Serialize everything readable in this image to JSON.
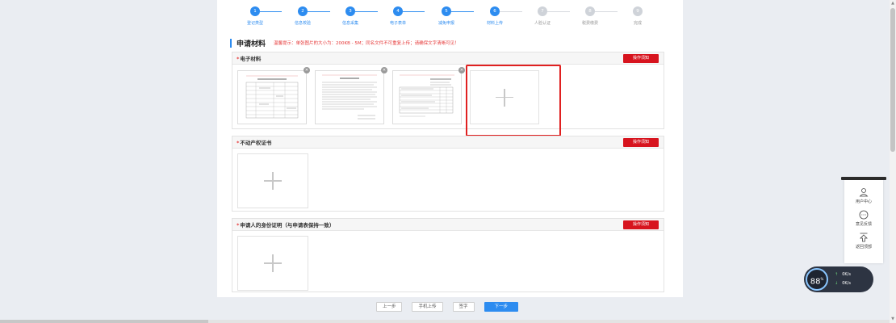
{
  "steps": [
    {
      "num": "1",
      "label": "登记类型",
      "done": true
    },
    {
      "num": "2",
      "label": "信息校验",
      "done": true
    },
    {
      "num": "3",
      "label": "信息采集",
      "done": true
    },
    {
      "num": "4",
      "label": "电子表单",
      "done": true
    },
    {
      "num": "5",
      "label": "减免申报",
      "done": true
    },
    {
      "num": "6",
      "label": "材料上传",
      "done": true
    },
    {
      "num": "7",
      "label": "人脸认证",
      "done": false
    },
    {
      "num": "8",
      "label": "税费缴费",
      "done": false
    },
    {
      "num": "9",
      "label": "完成",
      "done": false
    }
  ],
  "heading": {
    "title": "申请材料",
    "tip": "温馨提示：单张图片的大小为：200KB - 5M；同名文件不可重复上传；请确保文字清晰可见！"
  },
  "sections": [
    {
      "star": "*",
      "name": "电子材料",
      "op_label": "操作须知"
    },
    {
      "star": "*",
      "name": "不动产权证书",
      "op_label": "操作须知"
    },
    {
      "star": "*",
      "name": "申请人的身份证明（与申请表保持一致）",
      "op_label": "操作须知"
    }
  ],
  "delete_icon": "✕",
  "footer": {
    "prev": "上一步",
    "mobile": "手机上传",
    "sign": "签字",
    "next": "下一步"
  },
  "float_panel": {
    "user_center": "用户中心",
    "feedback": "意见反馈",
    "back_top": "返回顶部"
  },
  "speed_widget": {
    "percent": "88",
    "percent_unit": "%",
    "up_value": "0",
    "down_value": "0",
    "unit": "K/s"
  },
  "colors": {
    "accent": "#2d8cf0",
    "danger": "#d7141e",
    "highlight": "#e02020"
  }
}
